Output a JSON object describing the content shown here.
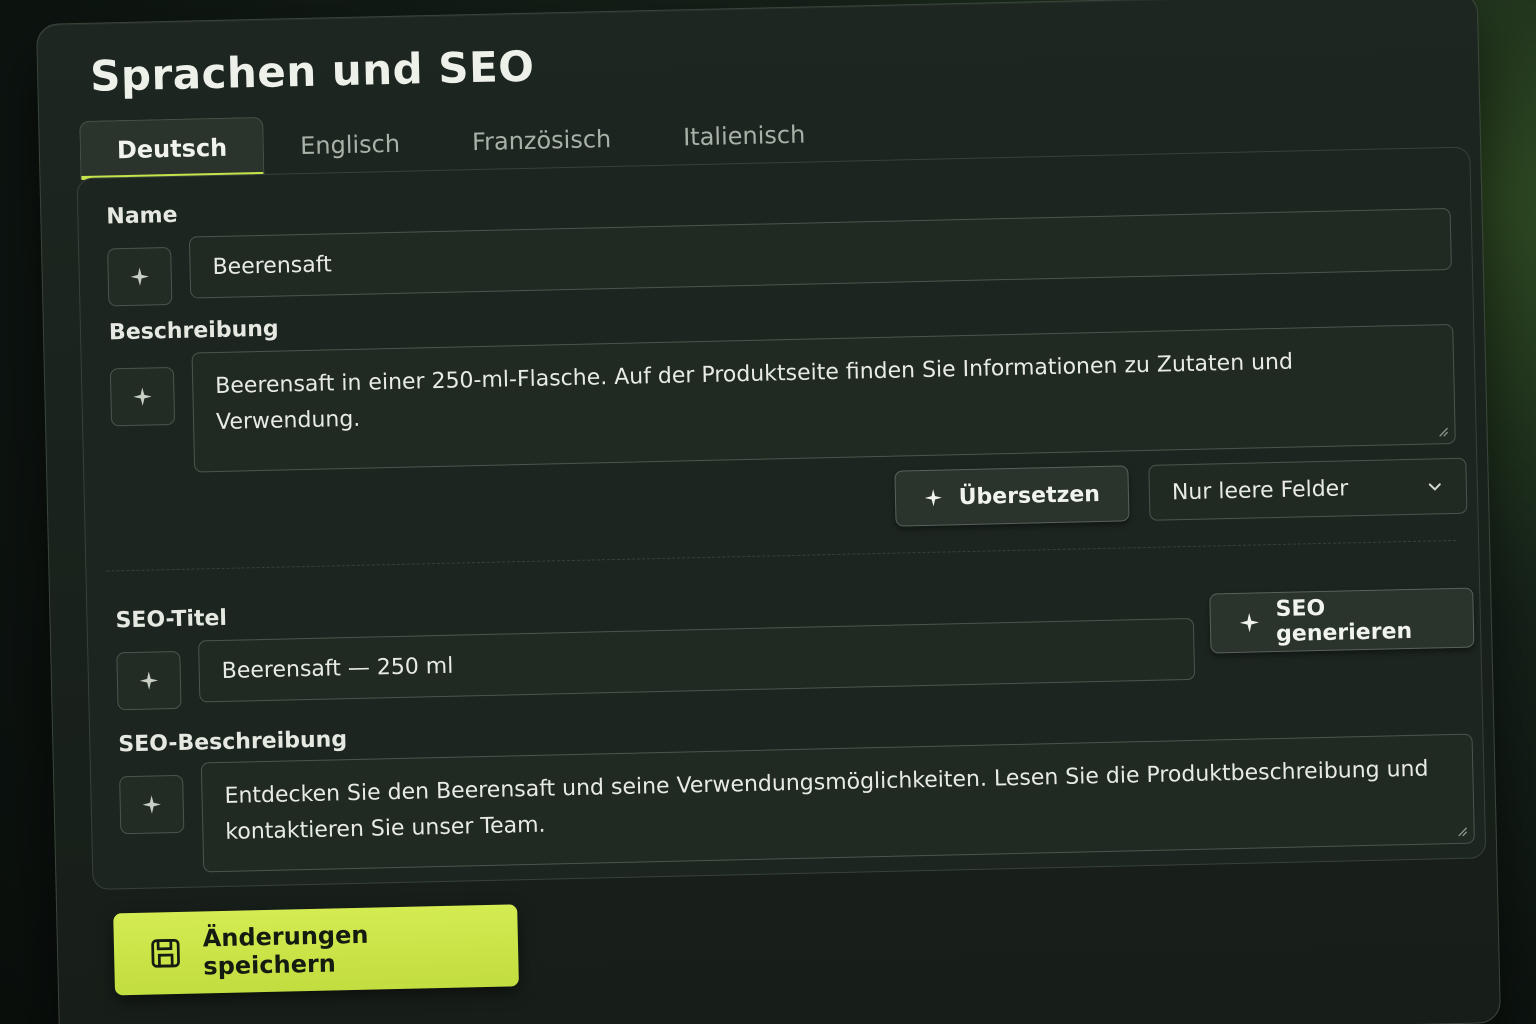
{
  "title": "Sprachen und SEO",
  "tabs": [
    {
      "label": "Deutsch",
      "active": true
    },
    {
      "label": "Englisch",
      "active": false
    },
    {
      "label": "Französisch",
      "active": false
    },
    {
      "label": "Italienisch",
      "active": false
    }
  ],
  "fields": {
    "name": {
      "label": "Name",
      "value": "Beerensaft"
    },
    "description": {
      "label": "Beschreibung",
      "value": "Beerensaft in einer 250-ml-Flasche. Auf der Produktseite finden Sie Informationen zu Zutaten und Verwendung."
    },
    "seo_title": {
      "label": "SEO-Titel",
      "value": "Beerensaft — 250 ml"
    },
    "seo_description": {
      "label": "SEO-Beschreibung",
      "value": "Entdecken Sie den Beerensaft und seine Verwendungsmöglichkeiten. Lesen Sie die Produktbeschreibung und kontaktieren Sie unser Team."
    }
  },
  "actions": {
    "translate_label": "Übersetzen",
    "translate_mode": "Nur leere Felder",
    "seo_generate_label": "SEO generieren",
    "save_label": "Änderungen speichern"
  },
  "icons": {
    "ai_assist": "sparkle-icon",
    "dropdown": "chevron-down-icon",
    "save": "floppy-disk-icon"
  },
  "colors": {
    "accent": "#c5e34a",
    "background": "#0d1410",
    "card": "#1d2620",
    "text": "#eef0ea"
  }
}
